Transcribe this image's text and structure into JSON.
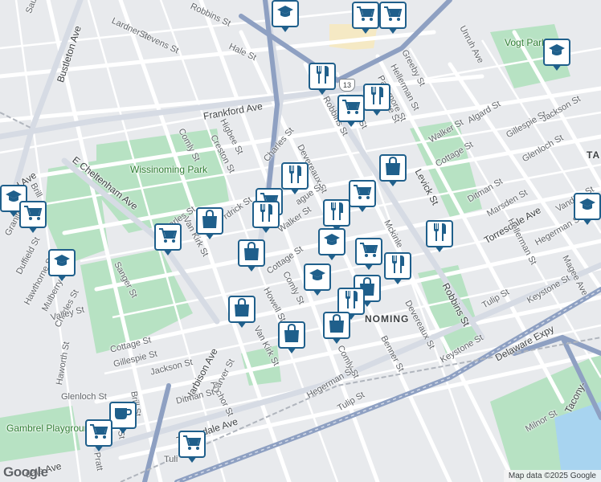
{
  "colors": {
    "background": "#e8eaed",
    "road": "#ffffff",
    "highway": "#8ea0c2",
    "park": "#b7e2c3",
    "water": "#a8d4f0",
    "pin_border": "#1f5f8b",
    "pin_icon": "#1f5f8b"
  },
  "labels": {
    "saul_st": "Saul St",
    "bustleton_ave": "Bustleton Ave",
    "lardner_st": "Lardner St",
    "stevens_st": "Stevens St",
    "robbins_st_top": "Robbins St",
    "hale_st": "Hale St",
    "unruh_ave": "Unruh Ave",
    "vogt_park": "Vogt Park",
    "greeby_st": "Greeby St",
    "hellerman_st_top": "Hellerman St",
    "passmore_st": "Passmore St",
    "frankford_ave": "Frankford Ave",
    "robbins_st_mid": "Robbins St",
    "walker_st_right": "Walker St",
    "algard_st": "Algard St",
    "gillespie_st_right": "Gillespie St",
    "jackson_st_right": "Jackson St",
    "glenloch_st_right": "Glenloch St",
    "cottage_st_right": "Cottage St",
    "comly_st_left": "Comly St",
    "higbee_st": "Higbee St",
    "creston_st": "Creston St",
    "charles_st_mid": "Charles St",
    "devereaux_st_mid": "Devereaux St",
    "levick_st": "Levick St",
    "ta": "TA",
    "wissinoming_park": "Wissinoming Park",
    "e_cheltenham_ave": "E Cheltenham Ave",
    "ford_ave": "ford Ave",
    "brill_st": "Brill",
    "granite_st": "Granite St",
    "duffield_st": "Duffield St",
    "hawthorne_st": "Hawthorne St",
    "mulberry_st": "Mulberry St",
    "charles_st_left": "Charles St",
    "valley_st": "Valley St",
    "haworth_st": "Haworth St",
    "sanger_st": "Sanger St",
    "van_kirk_st_left": "Van Kirk St",
    "charles_st_left2": "arles St",
    "fredrick_st": "rdrick St",
    "montague_st": "ague St",
    "walker_st_mid": "Walker St",
    "cottage_st_mid": "Cottage St",
    "comly_st_mid": "Comly St",
    "howell_st": "Howell St",
    "van_kirk_st_mid": "Van Kirk St",
    "ditman_st_right": "Ditman St",
    "marsden_st": "Marsden St",
    "torresdale_ave_right": "Torresdale Ave",
    "vandike_st": "Vandike St",
    "hegerman_st_right": "Hegerman St",
    "hellerman_st_right": "Hellerman St",
    "magee_ave": "Magee Ave",
    "keystone_st_right": "Keystone St",
    "tulip_st_right": "Tulip St",
    "robbins_st_low": "Robbins St",
    "devereaux_st_low": "Devereaux St",
    "keystone_st_low": "Keystone St",
    "mckinley_st": "Mckinle",
    "wissinoming_hood": "NOMING",
    "benner_st": "Benner St",
    "comly_st_low": "Comly St",
    "hegerman_st_low": "Hegerman St",
    "tulip_st_low": "Tulip St",
    "delaware_expy": "Delaware Expy",
    "tacony": "Tacony-",
    "milnor_st": "Milnor St",
    "cottage_st_left": "Cottage St",
    "gillespie_st_left": "Gillespie St",
    "jackson_st_left": "Jackson St",
    "harbison_ave": "Harbison Ave",
    "anchor_st": "Anchor St",
    "carver_st": "Carver St",
    "glenloch_st_left": "Glenloch St",
    "ditman_st_left": "Ditman St",
    "torresdale_ave_left": "Torresdale Ave",
    "brill_st_low": "Brill St",
    "gambrel_playground": "Gambrel Playground",
    "tulip_st_left": "Tuli",
    "pratt_st": "Pratt",
    "dale_ave": "dale Ave",
    "hedge_st": "dge St",
    "route_13": "13",
    "ridge_st_label": "ridge St",
    "ing_st": "ing St"
  },
  "footer": {
    "logo": "Google",
    "attribution": "Map data ©2025 Google"
  },
  "pins": [
    {
      "icon": "school-icon"
    },
    {
      "icon": "grocery-icon"
    },
    {
      "icon": "grocery-icon"
    },
    {
      "icon": "restaurant-icon"
    },
    {
      "icon": "restaurant-icon"
    },
    {
      "icon": "grocery-icon"
    },
    {
      "icon": "school-icon"
    },
    {
      "icon": "restaurant-icon"
    },
    {
      "icon": "shopping-bag-icon"
    },
    {
      "icon": "grocery-icon"
    },
    {
      "icon": "restaurant-icon"
    },
    {
      "icon": "grocery-icon"
    },
    {
      "icon": "restaurant-icon"
    },
    {
      "icon": "shopping-bag-icon"
    },
    {
      "icon": "grocery-icon"
    },
    {
      "icon": "school-icon"
    },
    {
      "icon": "restaurant-icon"
    },
    {
      "icon": "shopping-bag-icon"
    },
    {
      "icon": "restaurant-icon"
    },
    {
      "icon": "grocery-icon"
    },
    {
      "icon": "school-icon"
    },
    {
      "icon": "shopping-bag-icon"
    },
    {
      "icon": "shopping-bag-icon"
    },
    {
      "icon": "school-icon"
    },
    {
      "icon": "restaurant-icon"
    },
    {
      "icon": "grocery-icon"
    },
    {
      "icon": "shopping-bag-icon"
    },
    {
      "icon": "shopping-bag-icon"
    },
    {
      "icon": "school-icon"
    },
    {
      "icon": "coffee-icon"
    },
    {
      "icon": "grocery-icon"
    },
    {
      "icon": "grocery-icon"
    },
    {
      "icon": "school-icon"
    }
  ]
}
